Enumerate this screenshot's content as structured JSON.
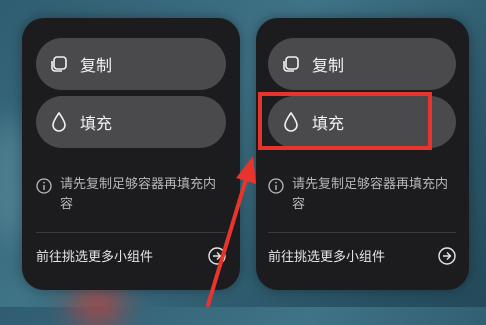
{
  "widgets": [
    {
      "copy_label": "复制",
      "fill_label": "填充",
      "tip_text": "请先复制足够容器再填充内容",
      "footer_text": "前往挑选更多小组件"
    },
    {
      "copy_label": "复制",
      "fill_label": "填充",
      "tip_text": "请先复制足够容器再填充内容",
      "footer_text": "前往挑选更多小组件"
    }
  ],
  "annotation": {
    "highlight_color": "#e8342c",
    "arrow_color": "#e8342c"
  },
  "icons": {
    "copy": "copy-icon",
    "fill": "drop-icon",
    "info": "info-icon",
    "go": "arrow-right-circle-icon"
  }
}
